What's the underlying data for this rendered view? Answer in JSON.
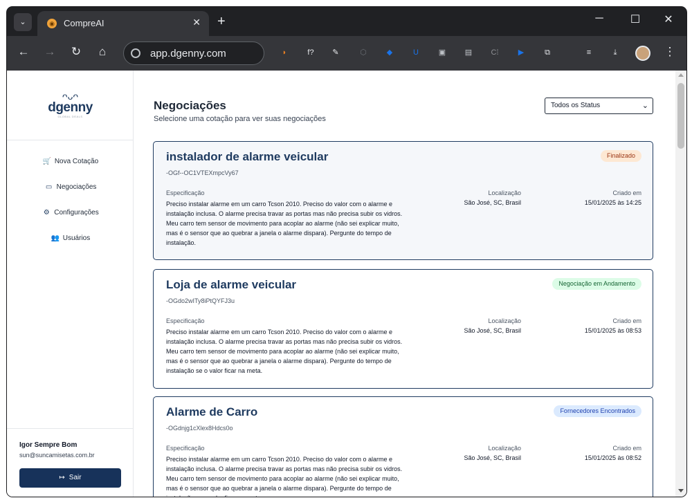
{
  "browser": {
    "tab_title": "CompreAI",
    "tab_close": "✕",
    "new_tab": "+",
    "url": "app.dgenny.com",
    "window_controls": {
      "minimize": "─",
      "maximize": "☐",
      "close": "✕"
    },
    "extensions": [
      {
        "name": "profile-ext-icon",
        "glyph": "◗",
        "color": "#e67e22"
      },
      {
        "name": "formula-ext-icon",
        "glyph": "f?",
        "color": "#e8eaed"
      },
      {
        "name": "pen-ext-icon",
        "glyph": "✎",
        "color": "#e8eaed"
      },
      {
        "name": "hex-ext-icon",
        "glyph": "⬡",
        "color": "#6b6f75"
      },
      {
        "name": "tag-ext-icon",
        "glyph": "◆",
        "color": "#1a73e8"
      },
      {
        "name": "u-ext-icon",
        "glyph": "U",
        "color": "#1a73e8"
      },
      {
        "name": "chat-ext-icon",
        "glyph": "▣",
        "color": "#bdc1c6"
      },
      {
        "name": "shield-ext-icon",
        "glyph": "▤",
        "color": "#bdc1c6"
      },
      {
        "name": "ci-ext-icon",
        "glyph": "C⁞",
        "color": "#8e9094"
      },
      {
        "name": "play-ext-icon",
        "glyph": "▶",
        "color": "#1a73e8"
      },
      {
        "name": "puzzle-ext-icon",
        "glyph": "⧉",
        "color": "#e8eaed"
      },
      {
        "name": "media-ext-icon",
        "glyph": "≡",
        "color": "#e8eaed"
      },
      {
        "name": "download-icon",
        "glyph": "⤓",
        "color": "#e8eaed"
      }
    ]
  },
  "sidebar": {
    "brand_owl": "ᴖᴗᴖ",
    "brand_name": "dgenny",
    "brand_tagline": "GLOBAL DEALS",
    "items": [
      {
        "label": "Nova Cotação",
        "icon": "🛒"
      },
      {
        "label": "Negociações",
        "icon": "▭"
      },
      {
        "label": "Configurações",
        "icon": "⚙"
      },
      {
        "label": "Usuários",
        "icon": "👥"
      }
    ],
    "user_name": "Igor Sempre Bom",
    "user_email": "sun@suncamisetas.com.br",
    "logout_label": "Sair",
    "logout_icon": "↦"
  },
  "main": {
    "title": "Negociações",
    "subtitle": "Selecione uma cotação para ver suas negociações",
    "status_filter": "Todos os Status",
    "labels": {
      "spec": "Especificação",
      "location": "Localização",
      "created": "Criado em"
    },
    "cards": [
      {
        "title": "instalador de alarme veicular",
        "id": "-OGf--OC1VTEXmpcVy67",
        "status": "Finalizado",
        "status_bg": "#fde8d3",
        "status_color": "#9a3412",
        "spec": "Preciso instalar alarme em um carro Tcson 2010. Preciso do valor com o alarme e instalação inclusa. O alarme precisa travar as portas mas não precisa subir os vidros. Meu carro tem sensor de movimento para acoplar ao alarme (não sei explicar muito, mas é o sensor que ao quebrar a janela o alarme dispara). Pergunte do tempo de instalação.",
        "location": "São José, SC, Brasil",
        "created": "15/01/2025 às 14:25"
      },
      {
        "title": "Loja de alarme veicular",
        "id": "-OGdo2wITy8iPtQYFJ3u",
        "status": "Negociação em Andamento",
        "status_bg": "#dcfce7",
        "status_color": "#166534",
        "spec": "Preciso instalar alarme em um carro Tcson 2010. Preciso do valor com o alarme e instalação inclusa. O alarme precisa travar as portas mas não precisa subir os vidros. Meu carro tem sensor de movimento para acoplar ao alarme (não sei explicar muito, mas é o sensor que ao quebrar a janela o alarme dispara). Pergunte do tempo de instalação se o valor ficar na meta.",
        "location": "São José, SC, Brasil",
        "created": "15/01/2025 às 08:53"
      },
      {
        "title": "Alarme de Carro",
        "id": "-OGdnjg1cXlex8Hdcs0o",
        "status": "Fornecedores Encontrados",
        "status_bg": "#dbeafe",
        "status_color": "#1e40af",
        "spec": "Preciso instalar alarme em um carro Tcson 2010. Preciso do valor com o alarme e instalação inclusa. O alarme precisa travar as portas mas não precisa subir os vidros. Meu carro tem sensor de movimento para acoplar ao alarme (não sei explicar muito, mas é o sensor que ao quebrar a janela o alarme dispara). Pergunte do tempo de instalação se o valor ficar na meta.",
        "location": "São José, SC, Brasil",
        "created": "15/01/2025 às 08:52"
      }
    ]
  }
}
